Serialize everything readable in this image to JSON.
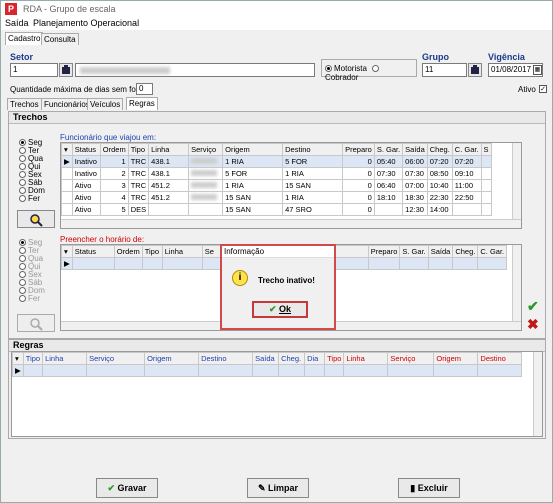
{
  "window": {
    "title": "RDA - Grupo de escala"
  },
  "menu": {
    "items": [
      "Saída",
      "Planejamento Operacional"
    ]
  },
  "tabs": {
    "top": [
      "Cadastro",
      "Consulta"
    ],
    "inner": [
      "Trechos",
      "Funcionários",
      "Veículos",
      "Regras"
    ]
  },
  "header": {
    "setor_label": "Setor",
    "setor_value": "1",
    "radio_motorista": "Motorista",
    "radio_cobrador": "Cobrador",
    "grupo_label": "Grupo",
    "grupo_value": "11",
    "vigencia_label": "Vigência",
    "vigencia_value": "01/08/2017",
    "dias_label": "Quantidade máxima de dias sem folga",
    "dias_value": "0",
    "ativo_label": "Ativo"
  },
  "trechos": {
    "section_title": "Trechos",
    "days": [
      "Seg",
      "Ter",
      "Qua",
      "Qui",
      "Sex",
      "Sáb",
      "Dom",
      "Fer"
    ],
    "grid_title": "Funcionário que viajou em:",
    "columns": [
      "Status",
      "Ordem",
      "Tipo",
      "Linha",
      "Serviço",
      "Origem",
      "Destino",
      "Preparo",
      "S. Gar.",
      "Saída",
      "Cheg.",
      "C. Gar.",
      "S"
    ],
    "rows": [
      [
        "Inativo",
        "1",
        "TRC",
        "438.1",
        "",
        "1 RIA",
        "5 FOR",
        "0",
        "05:40",
        "06:00",
        "07:20",
        "07:20"
      ],
      [
        "Inativo",
        "2",
        "TRC",
        "438.1",
        "",
        "5 FOR",
        "1 RIA",
        "0",
        "07:30",
        "07:30",
        "08:50",
        "09:10"
      ],
      [
        "Ativo",
        "3",
        "TRC",
        "451.2",
        "",
        "1 RIA",
        "15 SAN",
        "0",
        "06:40",
        "07:00",
        "10:40",
        "11:00"
      ],
      [
        "Ativo",
        "4",
        "TRC",
        "451.2",
        "",
        "15 SAN",
        "1 RIA",
        "0",
        "18:10",
        "18:30",
        "22:30",
        "22:50"
      ],
      [
        "Ativo",
        "5",
        "DES",
        "",
        "",
        "15 SAN",
        "47 SRO",
        "0",
        "",
        "12:30",
        "14:00",
        ""
      ]
    ],
    "grid2_title": "Preencher o horário de:",
    "columns2": [
      "Status",
      "Ordem",
      "Tipo",
      "Linha",
      "Se",
      "Preparo",
      "S. Gar.",
      "Saída",
      "Cheg.",
      "C. Gar."
    ]
  },
  "regras": {
    "section_title": "Regras",
    "columns_blue": [
      "Tipo",
      "Linha",
      "Serviço",
      "Origem",
      "Destino",
      "Saída",
      "Cheg.",
      "Dia"
    ],
    "columns_red": [
      "Tipo",
      "Linha",
      "Serviço",
      "Origem",
      "Destino"
    ]
  },
  "dialog": {
    "title": "Informação",
    "message": "Trecho inativo!",
    "ok": "Ok"
  },
  "footer": {
    "save": "Gravar",
    "clear": "Limpar",
    "delete": "Excluir"
  }
}
